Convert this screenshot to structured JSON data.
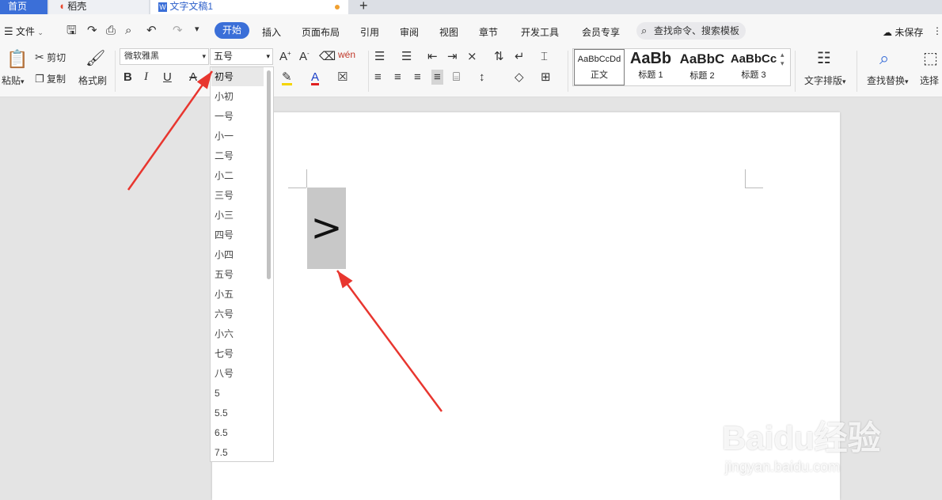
{
  "tabs": {
    "home": "首页",
    "daoke": "稻壳",
    "doc": "文字文稿1"
  },
  "menu": {
    "file": "文件",
    "items": [
      "开始",
      "插入",
      "页面布局",
      "引用",
      "审阅",
      "视图",
      "章节",
      "开发工具",
      "会员专享"
    ],
    "search_placeholder": "查找命令、搜索模板",
    "unsaved": "未保存"
  },
  "ribbon": {
    "paste": "粘贴",
    "cut": "剪切",
    "copy": "复制",
    "format_painter": "格式刷",
    "font_name": "微软雅黑",
    "font_size": "五号",
    "styles": [
      {
        "preview": "AaBbCcDd",
        "name": "正文"
      },
      {
        "preview": "AaBb",
        "name": "标题 1"
      },
      {
        "preview": "AaBbC",
        "name": "标题 2"
      },
      {
        "preview": "AaBbCc",
        "name": "标题 3"
      }
    ],
    "text_layout": "文字排版",
    "find_replace": "查找替换",
    "select": "选择"
  },
  "font_size_options": [
    "初号",
    "小初",
    "一号",
    "小一",
    "二号",
    "小二",
    "三号",
    "小三",
    "四号",
    "小四",
    "五号",
    "小五",
    "六号",
    "小六",
    "七号",
    "八号",
    "5",
    "5.5",
    "6.5",
    "7.5"
  ],
  "selected_size": "初号",
  "document": {
    "selected_text": ">"
  },
  "watermark": {
    "brand": "Baidu经验",
    "url": "jingyan.baidu.com"
  },
  "colors": {
    "accent": "#3b6fd8",
    "arrow": "#e8362f",
    "selection": "#c8c8c8"
  }
}
